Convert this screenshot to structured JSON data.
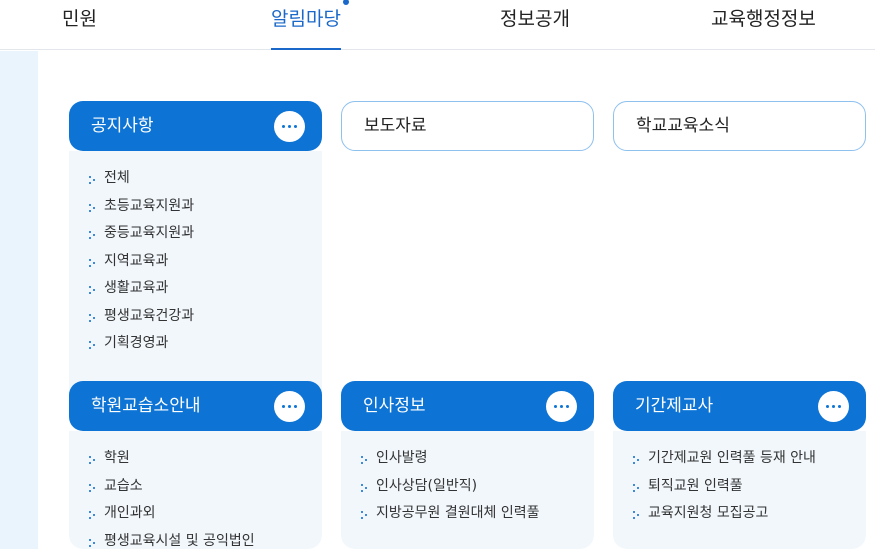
{
  "nav": {
    "items": [
      {
        "label": "민원",
        "active": false
      },
      {
        "label": "알림마당",
        "active": true
      },
      {
        "label": "정보공개",
        "active": false
      },
      {
        "label": "교육행정정보",
        "active": false
      }
    ]
  },
  "colors": {
    "accent": "#0d74d6",
    "panel": "#f2f7fc",
    "strip": "#e9f4fc",
    "outline": "#8ec1ee"
  },
  "more_icon": "ellipsis-icon",
  "cards": {
    "notice": {
      "title": "공지사항",
      "items": [
        "전체",
        "초등교육지원과",
        "중등교육지원과",
        "지역교육과",
        "생활교육과",
        "평생교육건강과",
        "기획경영과"
      ]
    },
    "press": {
      "title": "보도자료"
    },
    "school_news": {
      "title": "학교교육소식"
    },
    "academy": {
      "title": "학원교습소안내",
      "items": [
        "학원",
        "교습소",
        "개인과외",
        "평생교육시설 및 공익법인"
      ]
    },
    "personnel": {
      "title": "인사정보",
      "items": [
        "인사발령",
        "인사상담(일반직)",
        "지방공무원 결원대체 인력풀"
      ]
    },
    "contract_teacher": {
      "title": "기간제교사",
      "items": [
        "기간제교원 인력풀 등재 안내",
        "퇴직교원 인력풀",
        "교육지원청 모집공고"
      ]
    }
  }
}
